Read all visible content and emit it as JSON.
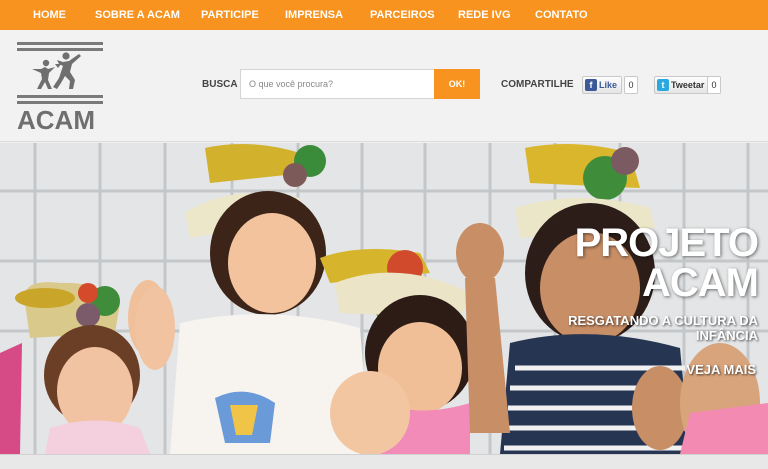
{
  "nav": {
    "items": [
      "HOME",
      "SOBRE A ACAM",
      "PARTICIPE",
      "IMPRENSA",
      "PARCEIROS",
      "REDE IVG",
      "CONTATO"
    ]
  },
  "header": {
    "logo_text": "ACAM",
    "search_label": "BUSCA",
    "search_placeholder": "O que você procura?",
    "search_button": "OK!",
    "share_label": "COMPARTILHE",
    "facebook_like": "Like",
    "facebook_count": "0",
    "tweet_label": "Tweetar",
    "tweet_count": "0"
  },
  "hero": {
    "title_line1": "PROJETO",
    "title_line2": "ACAM",
    "subtitle": "RESGATANDO A CULTURA DA INFÂNCIA",
    "cta": "VEJA MAIS"
  },
  "colors": {
    "accent": "#f7931e",
    "logo_gray": "#7a7a7a",
    "facebook": "#3b5998",
    "twitter": "#2aa9e0"
  }
}
